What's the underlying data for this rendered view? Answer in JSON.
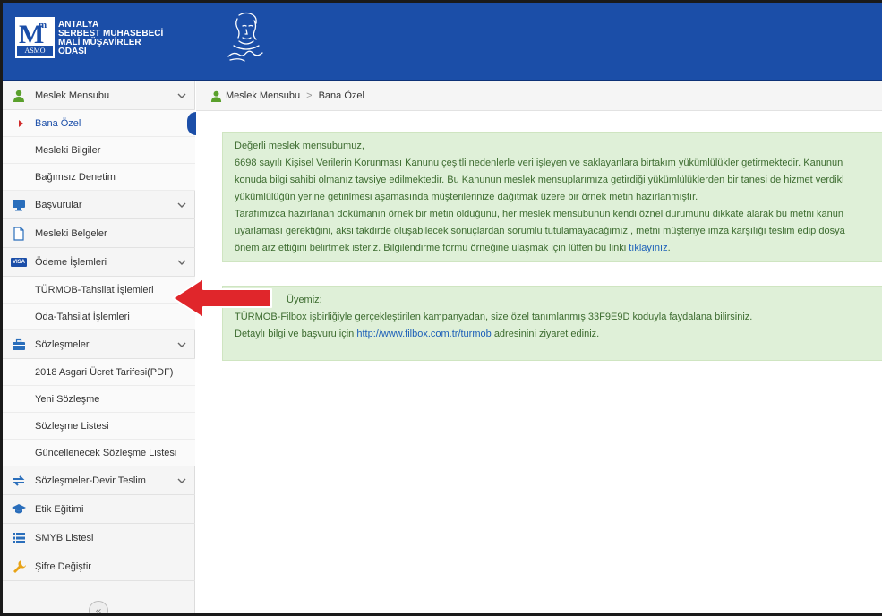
{
  "header": {
    "logo_lines": [
      "ANTALYA",
      "SERBEST MUHASEBECİ",
      "MALİ MÜŞAVİRLER",
      "ODASI"
    ],
    "logo_badge": "ASMO",
    "logo_letter": "M",
    "logo_superscript": "m"
  },
  "sidebar": {
    "items": [
      {
        "label": "Meslek Mensubu",
        "icon": "user-icon",
        "expandable": true
      },
      {
        "label": "Bana Özel"
      },
      {
        "label": "Mesleki Bilgiler"
      },
      {
        "label": "Bağımsız Denetim"
      },
      {
        "label": "Başvurular",
        "icon": "monitor-icon",
        "expandable": true
      },
      {
        "label": "Mesleki Belgeler",
        "icon": "document-icon"
      },
      {
        "label": "Ödeme İşlemleri",
        "icon": "visa-icon",
        "expandable": true
      },
      {
        "label": "TÜRMOB-Tahsilat İşlemleri"
      },
      {
        "label": "Oda-Tahsilat İşlemleri"
      },
      {
        "label": "Sözleşmeler",
        "icon": "briefcase-icon",
        "expandable": true
      },
      {
        "label": "2018 Asgari Ücret Tarifesi(PDF)"
      },
      {
        "label": "Yeni Sözleşme"
      },
      {
        "label": "Sözleşme Listesi"
      },
      {
        "label": "Güncellenecek Sözleşme Listesi"
      },
      {
        "label": "Sözleşmeler-Devir Teslim",
        "icon": "transfer-icon",
        "expandable": true
      },
      {
        "label": "Etik Eğitimi",
        "icon": "graduation-cap-icon"
      },
      {
        "label": "SMYB Listesi",
        "icon": "list-icon"
      },
      {
        "label": "Şifre Değiştir",
        "icon": "wrench-icon"
      }
    ],
    "visa_text": "VISA",
    "collapse_glyph": "«"
  },
  "breadcrumb": {
    "root": "Meslek Mensubu",
    "separator": ">",
    "current": "Bana Özel"
  },
  "notice1": {
    "greeting": "Değerli meslek mensubumuz,",
    "line1": "6698 sayılı Kişisel Verilerin Korunması Kanunu çeşitli nedenlerle veri işleyen ve saklayanlara birtakım yükümlülükler getirmektedir. Kanunun",
    "line2": "konuda bilgi sahibi olmanız tavsiye edilmektedir. Bu Kanunun meslek mensuplarımıza getirdiği yükümlülüklerden bir tanesi de hizmet verdikl",
    "line3": "yükümlülüğün yerine getirilmesi aşamasında müşterilerinize dağıtmak üzere bir örnek metin hazırlanmıştır.",
    "line4": "Tarafımızca hazırlanan dokümanın örnek bir metin olduğunu, her meslek mensubunun kendi öznel durumunu dikkate alarak bu metni kanun",
    "line5": "uyarlaması gerektiğini, aksi takdirde oluşabilecek sonuçlardan sorumlu tutulamayacağımızı, metni müşteriye imza karşılığı teslim edip dosya",
    "line6_prefix": "önem arz ettiğini belirtmek isteriz. Bilgilendirme formu örneğine ulaşmak için lütfen bu linki",
    "link": "tıklayınız",
    "line6_suffix": "."
  },
  "notice2": {
    "greeting": "Üyemiz;",
    "line1": "TÜRMOB-Filbox işbirliğiyle gerçekleştirilen kampanyadan, size özel tanımlanmış 33F9E9D koduyla faydalana bilirsiniz.",
    "line2_prefix": "Detaylı bilgi ve başvuru için",
    "link": "http://www.filbox.com.tr/turmob",
    "line2_suffix": "adresinini ziyaret ediniz."
  },
  "colors": {
    "header_bg": "#1b4ea8",
    "alert_bg": "#dff0d8",
    "alert_text": "#3c6b2f",
    "link": "#1b5fb8",
    "arrow": "#e0262b"
  }
}
